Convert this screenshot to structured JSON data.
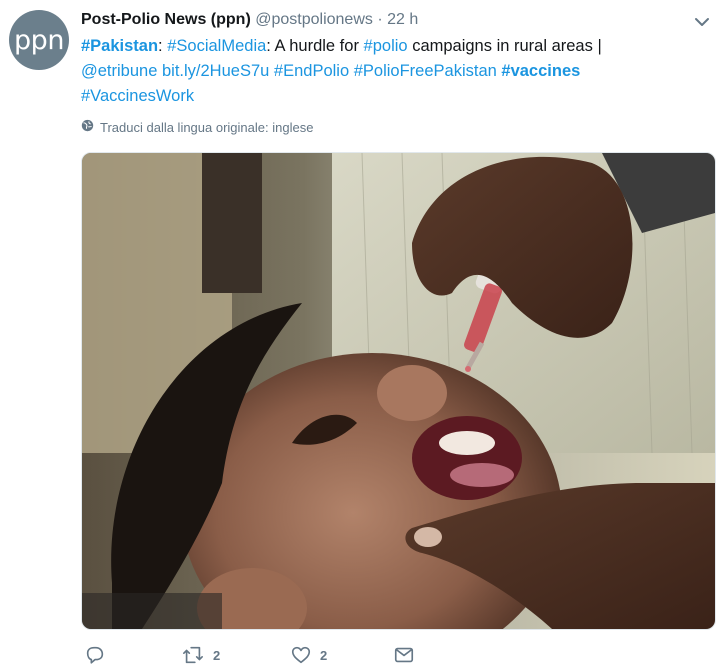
{
  "tweet": {
    "avatar_text": "ppn",
    "display_name": "Post-Polio News (ppn)",
    "handle": "@postpolionews",
    "separator": "·",
    "time": "22 h",
    "text": {
      "hashtag_pakistan": "#Pakistan",
      "colon1": ":",
      "hashtag_socialmedia": "#SocialMedia",
      "plain1": ": A hurdle for",
      "hashtag_polio": "#polio",
      "plain2": "campaigns in rural areas |",
      "mention_etribune": "@etribune",
      "link": "bit.ly/2HueS7u",
      "hashtag_endpolio": "#EndPolio",
      "hashtag_poliofree": "#PolioFreePakistan",
      "hashtag_vaccines": "#vaccines",
      "hashtag_vaccineswork": "#VaccinesWork"
    },
    "translate_label": "Traduci dalla lingua originale: inglese",
    "retweet_count": "2",
    "like_count": "2"
  },
  "colors": {
    "link": "#1b95e0",
    "muted": "#657786",
    "avatar_bg": "#6b7f8c"
  },
  "icons": [
    "chevron-down-icon",
    "globe-icon",
    "reply-icon",
    "retweet-icon",
    "heart-icon",
    "message-icon"
  ]
}
